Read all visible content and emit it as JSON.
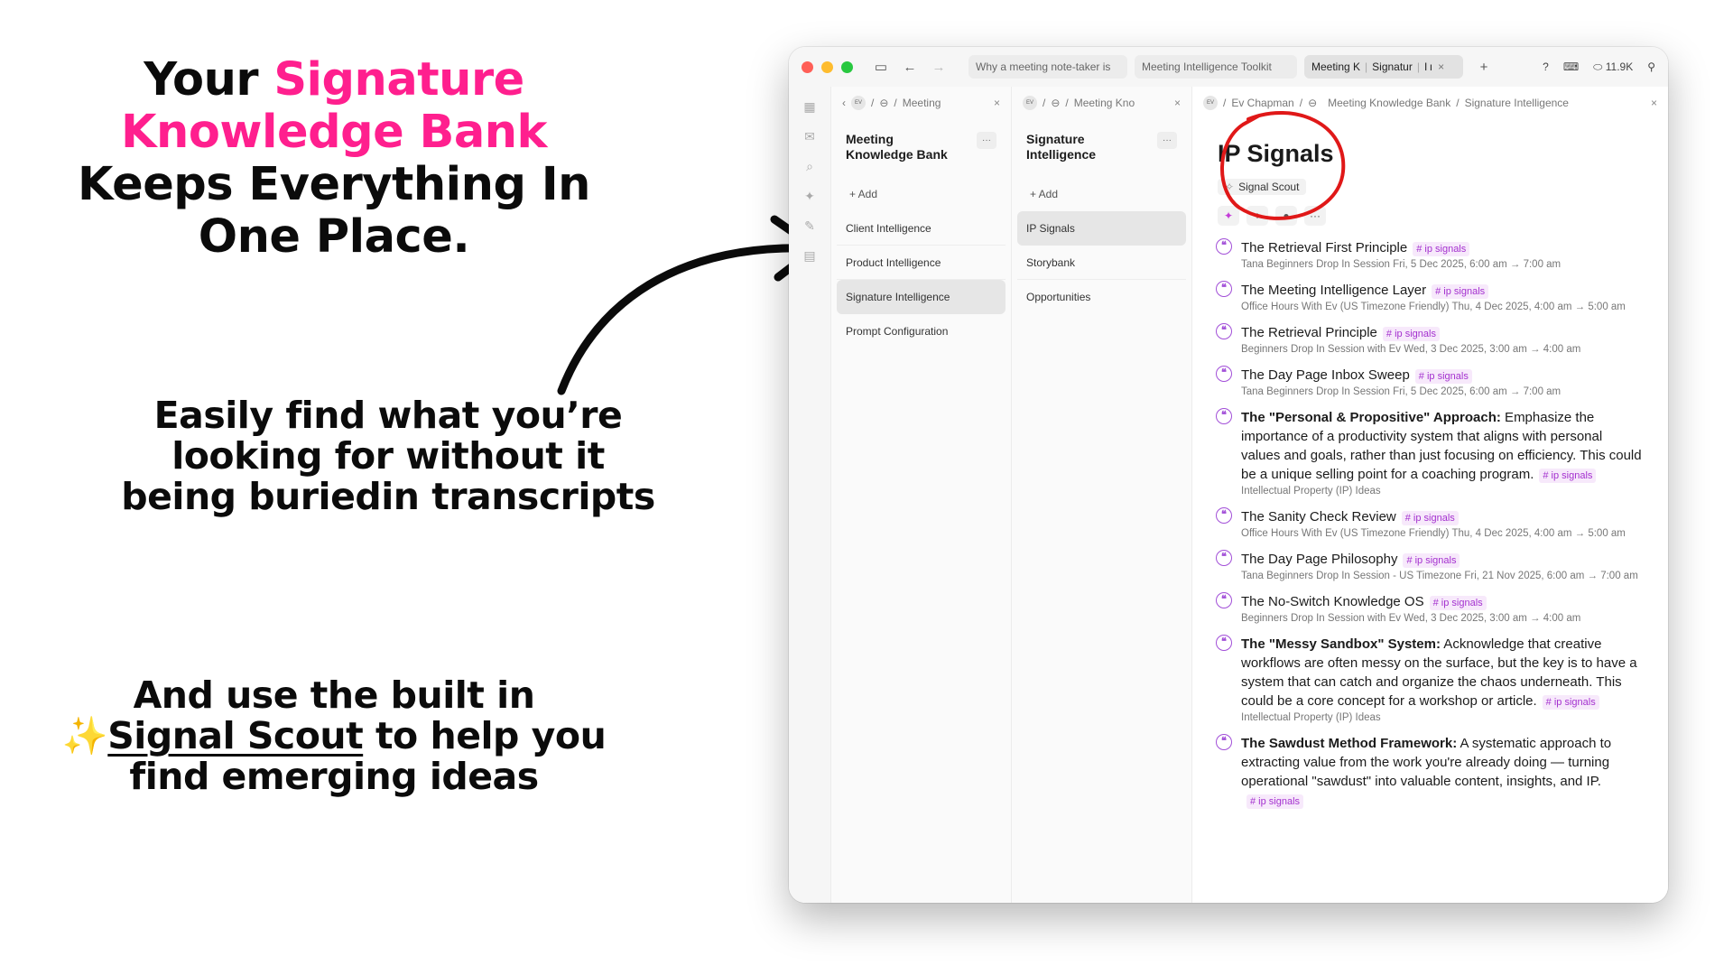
{
  "promo": {
    "headline_before": "Your ",
    "headline_pink": "Signature Knowledge Bank",
    "headline_after": " Keeps Everything In One Place.",
    "mid": "Easily find what you’re looking for without it being buriedin transcripts",
    "bottom_prefix": "And use the built in",
    "bottom_emoji": "✨",
    "bottom_link": "Signal Scout",
    "bottom_suffix": " to help you find emerging ideas",
    "pink_color": "#ff1f8e"
  },
  "titlebar": {
    "tabs": [
      "Why a meeting note-taker is",
      "Meeting Intelligence Toolkit"
    ],
    "active_tab_a": "Meeting K",
    "active_tab_b": "Signatur",
    "active_tab_c": "I ı",
    "count": "11.9K"
  },
  "col1": {
    "crumb": "Meeting",
    "title": "Meeting Knowledge Bank",
    "add": "+ Add",
    "items": [
      "Client Intelligence",
      "Product Intelligence",
      "Signature Intelligence",
      "Prompt Configuration"
    ]
  },
  "col2": {
    "crumb": "Meeting Kno",
    "title": "Signature Intelligence",
    "add": "+ Add",
    "items": [
      "IP Signals",
      "Storybank",
      "Opportunities"
    ]
  },
  "col3": {
    "crumb": [
      "Ev Chapman",
      "Meeting Knowledge Bank",
      "Signature Intelligence"
    ],
    "title": "IP Signals",
    "scout": "Signal Scout",
    "tag": "# ip signals",
    "entries": [
      {
        "title": "The Retrieval First Principle",
        "meta": "Tana Beginners Drop In Session Fri, 5 Dec 2025, 6:00 am → 7:00 am"
      },
      {
        "title": "The Meeting Intelligence Layer",
        "meta": "Office Hours With Ev (US Timezone Friendly) Thu, 4 Dec 2025, 4:00 am → 5:00 am"
      },
      {
        "title": "The Retrieval Principle",
        "meta": "Beginners Drop In Session with Ev Wed, 3 Dec 2025, 3:00 am → 4:00 am"
      },
      {
        "title": "The Day Page Inbox Sweep",
        "meta": "Tana Beginners Drop In Session Fri, 5 Dec 2025, 6:00 am → 7:00 am"
      },
      {
        "bold": "The \"Personal & Propositive\" Approach:",
        "title": " Emphasize the importance of a productivity system that aligns with personal values and goals, rather than just focusing on efficiency. This could be a unique selling point for a coaching program.",
        "meta": "Intellectual Property (IP) Ideas"
      },
      {
        "title": "The Sanity Check Review",
        "meta": "Office Hours With Ev (US Timezone Friendly) Thu, 4 Dec 2025, 4:00 am → 5:00 am"
      },
      {
        "title": "The Day Page Philosophy",
        "meta": "Tana Beginners Drop In Session - US Timezone Fri, 21 Nov 2025, 6:00 am → 7:00 am"
      },
      {
        "title": "The No-Switch Knowledge OS",
        "meta": "Beginners Drop In Session with Ev Wed, 3 Dec 2025, 3:00 am → 4:00 am"
      },
      {
        "bold": "The \"Messy Sandbox\" System:",
        "title": " Acknowledge that creative workflows are often messy on the surface, but the key is to have a system that can catch and organize the chaos underneath. This could be a core concept for a workshop or article.",
        "meta": "Intellectual Property (IP) Ideas"
      },
      {
        "bold": "The Sawdust Method Framework:",
        "title": " A systematic approach to extracting value from the work you're already doing — turning operational \"sawdust\" into valuable content, insights, and IP.",
        "meta": ""
      }
    ]
  }
}
